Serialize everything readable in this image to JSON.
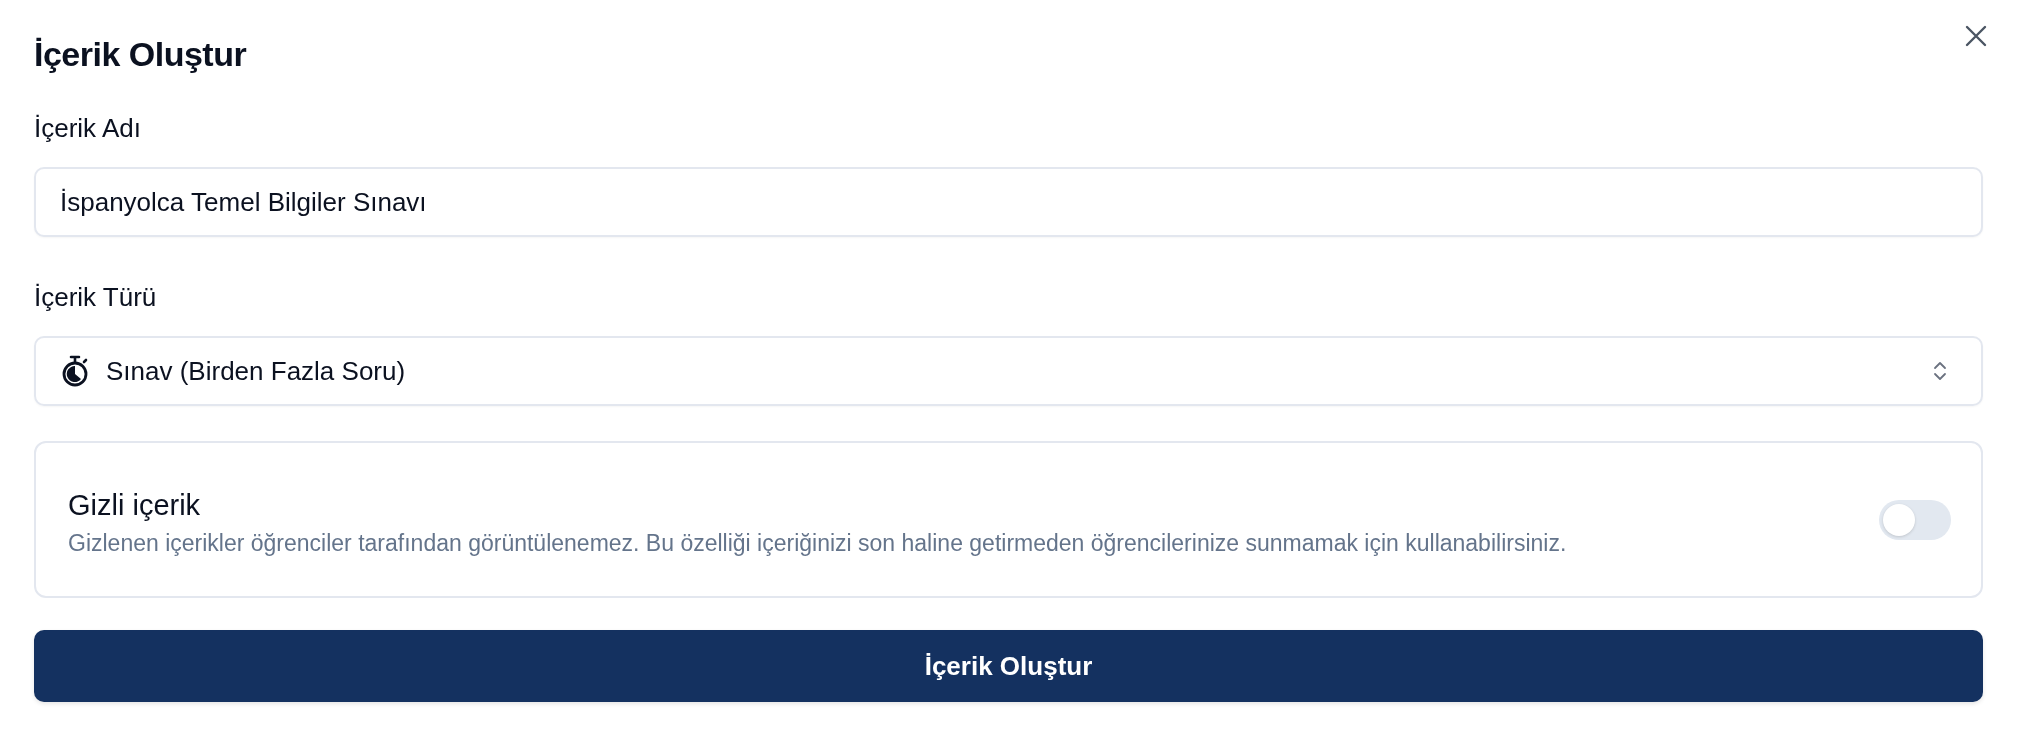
{
  "dialog": {
    "title": "İçerik Oluştur"
  },
  "fields": [
    {
      "kind": "text",
      "label": "İçerik Adı",
      "value": "İspanyolca Temel Bilgiler Sınavı"
    },
    {
      "kind": "select",
      "label": "İçerik Türü",
      "value": "Sınav (Birden Fazla Soru)"
    }
  ],
  "hidden_setting": {
    "title": "Gizli içerik",
    "description": "Gizlenen içerikler öğrenciler tarafından görüntülenemez. Bu özelliği içeriğinizi son haline getirmeden öğrencilerinize sunmamak için kullanabilirsiniz.",
    "on": false
  },
  "submit_button": "İçerik Oluştur"
}
